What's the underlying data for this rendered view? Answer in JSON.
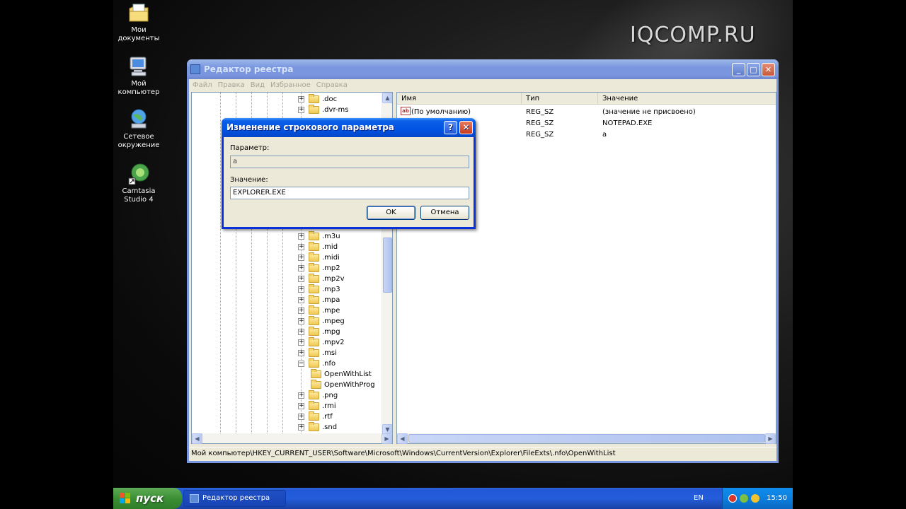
{
  "watermark": "IQCOMP.RU",
  "desktop_icons": [
    {
      "line1": "Мои",
      "line2": "документы"
    },
    {
      "line1": "Мой",
      "line2": "компьютер"
    },
    {
      "line1": "Сетевое",
      "line2": "окружение"
    },
    {
      "line1": "Camtasia",
      "line2": "Studio 4"
    }
  ],
  "regedit": {
    "title": "Редактор реестра",
    "menu": [
      "Файл",
      "Правка",
      "Вид",
      "Избранное",
      "Справка"
    ],
    "tree": [
      {
        "label": ".doc",
        "expander": "+"
      },
      {
        "label": ".dvr-ms",
        "expander": "+"
      },
      {
        "label": ".m3u",
        "expander": "+"
      },
      {
        "label": ".mid",
        "expander": "+"
      },
      {
        "label": ".midi",
        "expander": "+"
      },
      {
        "label": ".mp2",
        "expander": "+"
      },
      {
        "label": ".mp2v",
        "expander": "+"
      },
      {
        "label": ".mp3",
        "expander": "+"
      },
      {
        "label": ".mpa",
        "expander": "+"
      },
      {
        "label": ".mpe",
        "expander": "+"
      },
      {
        "label": ".mpeg",
        "expander": "+"
      },
      {
        "label": ".mpg",
        "expander": "+"
      },
      {
        "label": ".mpv2",
        "expander": "+"
      },
      {
        "label": ".msi",
        "expander": "+"
      },
      {
        "label": ".nfo",
        "expander": "−"
      },
      {
        "label": "OpenWithList",
        "expander": ""
      },
      {
        "label": "OpenWithProg",
        "expander": ""
      },
      {
        "label": ".png",
        "expander": "+"
      },
      {
        "label": ".rmi",
        "expander": "+"
      },
      {
        "label": ".rtf",
        "expander": "+"
      },
      {
        "label": ".snd",
        "expander": "+"
      }
    ],
    "columns": [
      "Имя",
      "Тип",
      "Значение"
    ],
    "values": [
      {
        "name": "(По умолчанию)",
        "type": "REG_SZ",
        "data": "(значение не присвоено)"
      },
      {
        "name": "",
        "type": "REG_SZ",
        "data": "NOTEPAD.EXE"
      },
      {
        "name": "",
        "type": "REG_SZ",
        "data": "a"
      }
    ],
    "status": "Мой компьютер\\HKEY_CURRENT_USER\\Software\\Microsoft\\Windows\\CurrentVersion\\Explorer\\FileExts\\.nfo\\OpenWithList"
  },
  "dialog": {
    "title": "Изменение строкового параметра",
    "param_label": "Параметр:",
    "param_value": "a",
    "value_label": "Значение:",
    "value_value": "EXPLORER.EXE",
    "ok": "OK",
    "cancel": "Отмена",
    "help_glyph": "?",
    "close_glyph": "✕"
  },
  "taskbar": {
    "start": "пуск",
    "task": "Редактор реестра",
    "lang": "EN",
    "clock": "15:50"
  }
}
